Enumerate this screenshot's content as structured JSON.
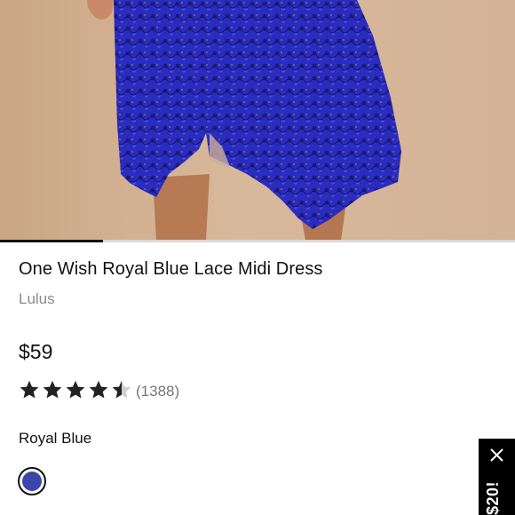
{
  "product": {
    "title": "One Wish Royal Blue Lace Midi Dress",
    "brand": "Lulus",
    "price": "$59",
    "rating_value": 4.5,
    "rating_max": 5,
    "review_count": "(1388)",
    "color_name": "Royal Blue",
    "swatch_color": "#3a46a8"
  },
  "gallery": {
    "progress_fraction": 0.2,
    "image_icon": "product-photo"
  },
  "promo": {
    "text": "$20!",
    "close_icon": "close-icon"
  },
  "colors": {
    "star": "#222222",
    "star_empty": "#cfcfcf",
    "dress": "#2b2fc4"
  }
}
